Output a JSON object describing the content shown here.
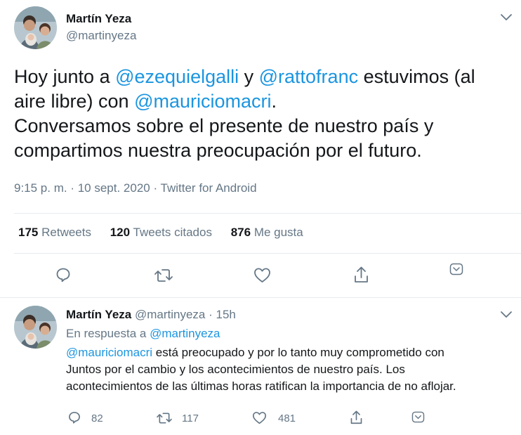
{
  "main_tweet": {
    "author_name": "Martín Yeza",
    "author_handle": "@martinyeza",
    "text_lines": [
      [
        {
          "t": "Hoy junto a "
        },
        {
          "t": "@ezequielgalli",
          "m": true
        },
        {
          "t": " y "
        },
        {
          "t": "@rattofranc",
          "m": true
        },
        {
          "t": " estuvimos (al"
        }
      ],
      [
        {
          "t": "aire libre) con "
        },
        {
          "t": "@mauriciomacri",
          "m": true
        },
        {
          "t": "."
        }
      ],
      [
        {
          "t": "Conversamos sobre el presente de nuestro país y"
        }
      ],
      [
        {
          "t": "compartimos nuestra preocupación por el futuro."
        }
      ]
    ],
    "meta": "9:15 p. m. · 10 sept. 2020 · Twitter for Android",
    "stats": {
      "retweets_count": "175",
      "retweets_label": "Retweets",
      "quotes_count": "120",
      "quotes_label": "Tweets citados",
      "likes_count": "876",
      "likes_label": "Me gusta"
    },
    "actions": [
      "reply-icon",
      "retweet-icon",
      "like-icon",
      "share-icon",
      "menu-caret-icon"
    ]
  },
  "reply_tweet": {
    "author_name": "Martín Yeza",
    "author_handle": "@martinyeza",
    "separator": "·",
    "time_ago": "15h",
    "reply_to_label": "En respuesta a",
    "reply_to_handle": "@martinyeza",
    "text_lines": [
      [
        {
          "t": "@mauriciomacri",
          "m": true
        },
        {
          "t": " está preocupado y por lo tanto muy comprometido con"
        }
      ],
      [
        {
          "t": "Juntos por el cambio y los acontecimientos de nuestro país. Los"
        }
      ],
      [
        {
          "t": "acontecimientos de las últimas horas ratifican la importancia de no aflojar."
        }
      ]
    ],
    "counts": {
      "replies": "82",
      "retweets": "117",
      "likes": "481"
    }
  },
  "colors": {
    "text": "#14171a",
    "secondary": "#657786",
    "link": "#1b95e0",
    "divider": "#e6ecf0"
  }
}
